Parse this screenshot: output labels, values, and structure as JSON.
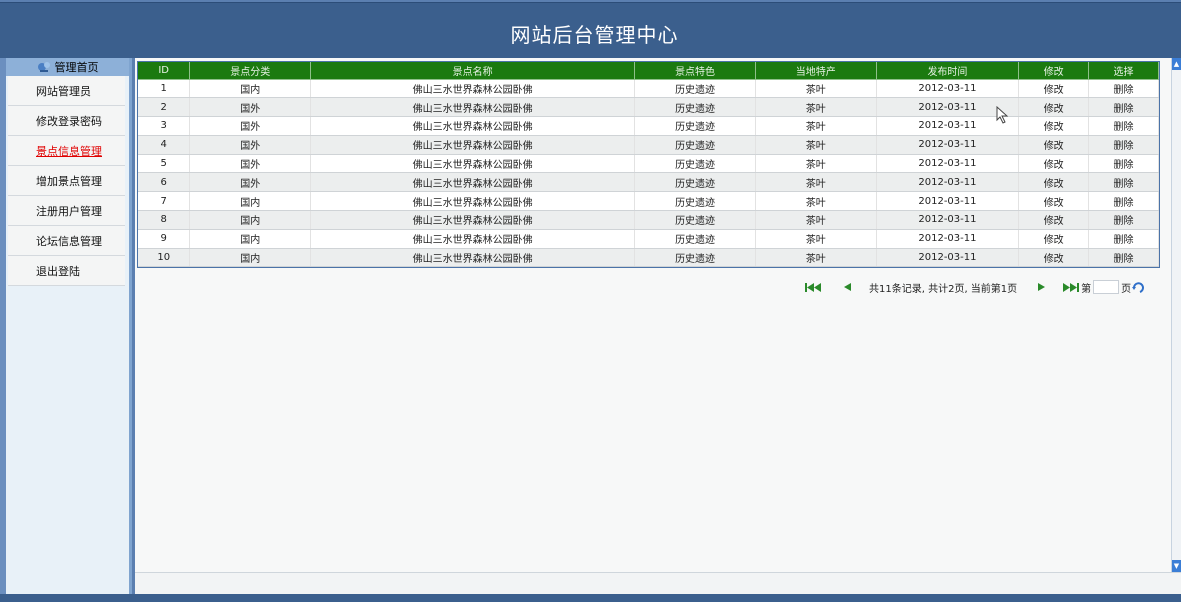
{
  "header": {
    "title": "网站后台管理中心"
  },
  "sidebar": {
    "home_label": "管理首页",
    "items": [
      {
        "label": "网站管理员"
      },
      {
        "label": "修改登录密码"
      },
      {
        "label": "景点信息管理"
      },
      {
        "label": "增加景点管理"
      },
      {
        "label": "注册用户管理"
      },
      {
        "label": "论坛信息管理"
      },
      {
        "label": "退出登陆"
      }
    ]
  },
  "table": {
    "columns": [
      "ID",
      "景点分类",
      "景点名称",
      "景点特色",
      "当地特产",
      "发布时间",
      "修改",
      "选择"
    ],
    "rows": [
      [
        "1",
        "国内",
        "佛山三水世界森林公园卧佛",
        "历史遗迹",
        "茶叶",
        "2012-03-11",
        "修改",
        "删除"
      ],
      [
        "2",
        "国外",
        "佛山三水世界森林公园卧佛",
        "历史遗迹",
        "茶叶",
        "2012-03-11",
        "修改",
        "删除"
      ],
      [
        "3",
        "国外",
        "佛山三水世界森林公园卧佛",
        "历史遗迹",
        "茶叶",
        "2012-03-11",
        "修改",
        "删除"
      ],
      [
        "4",
        "国外",
        "佛山三水世界森林公园卧佛",
        "历史遗迹",
        "茶叶",
        "2012-03-11",
        "修改",
        "删除"
      ],
      [
        "5",
        "国外",
        "佛山三水世界森林公园卧佛",
        "历史遗迹",
        "茶叶",
        "2012-03-11",
        "修改",
        "删除"
      ],
      [
        "6",
        "国外",
        "佛山三水世界森林公园卧佛",
        "历史遗迹",
        "茶叶",
        "2012-03-11",
        "修改",
        "删除"
      ],
      [
        "7",
        "国内",
        "佛山三水世界森林公园卧佛",
        "历史遗迹",
        "茶叶",
        "2012-03-11",
        "修改",
        "删除"
      ],
      [
        "8",
        "国内",
        "佛山三水世界森林公园卧佛",
        "历史遗迹",
        "茶叶",
        "2012-03-11",
        "修改",
        "删除"
      ],
      [
        "9",
        "国内",
        "佛山三水世界森林公园卧佛",
        "历史遗迹",
        "茶叶",
        "2012-03-11",
        "修改",
        "删除"
      ],
      [
        "10",
        "国内",
        "佛山三水世界森林公园卧佛",
        "历史遗迹",
        "茶叶",
        "2012-03-11",
        "修改",
        "删除"
      ]
    ]
  },
  "pager": {
    "info": "共11条记录, 共计2页, 当前第1页",
    "page_prefix": "第",
    "page_suffix": "页",
    "page_value": ""
  },
  "colors": {
    "header": "#3b5f8d",
    "table_header": "#1b7a0f",
    "active_link": "#e00000"
  }
}
